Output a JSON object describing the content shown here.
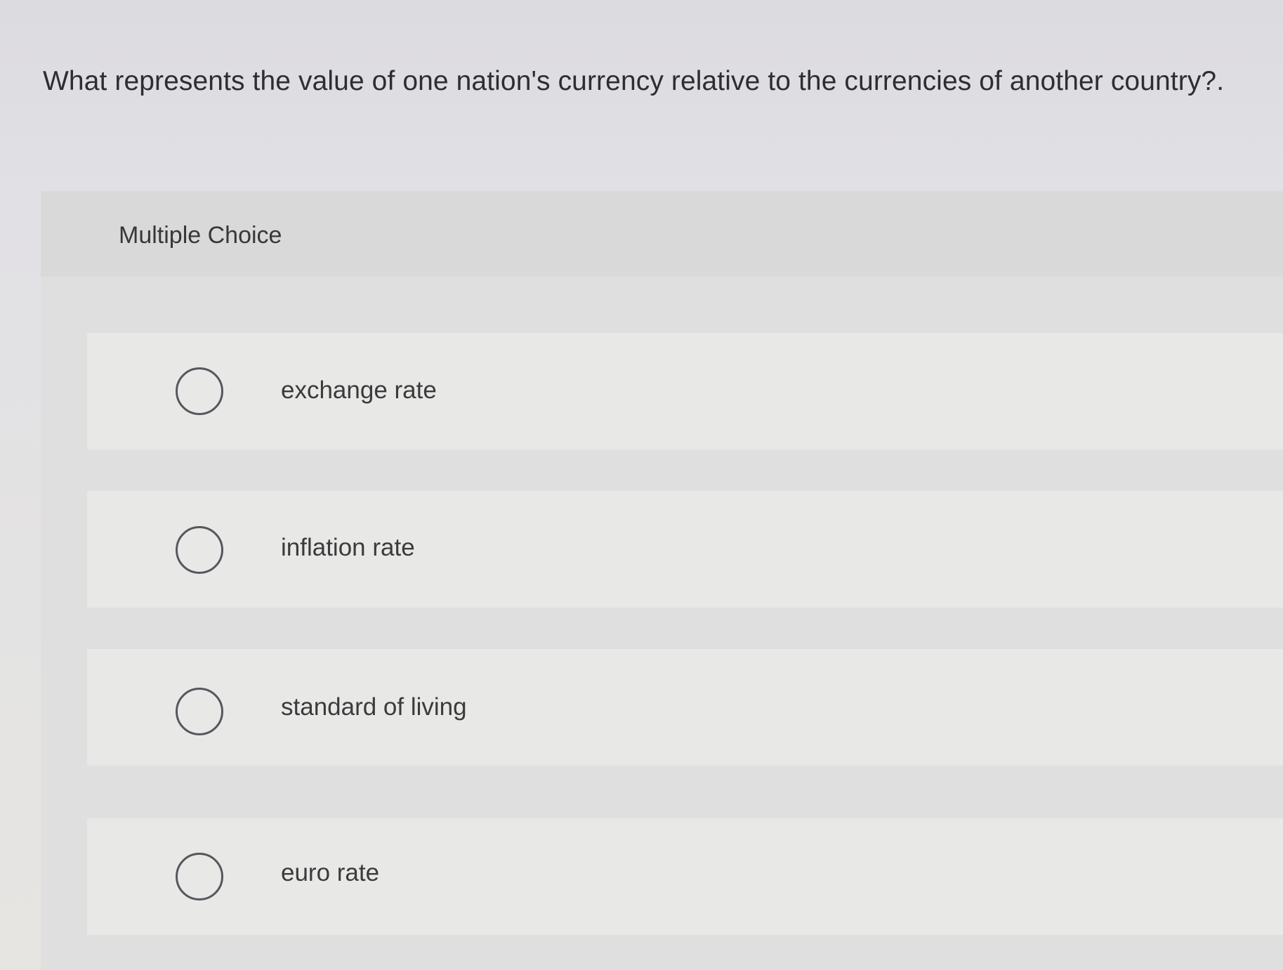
{
  "question": {
    "text": "What represents the value of one nation's currency relative to the currencies of another country?."
  },
  "panel": {
    "header": "Multiple Choice"
  },
  "options": [
    {
      "label": "exchange rate",
      "selected": false
    },
    {
      "label": "inflation rate",
      "selected": false
    },
    {
      "label": "standard of living",
      "selected": false
    },
    {
      "label": "euro rate",
      "selected": false
    }
  ]
}
